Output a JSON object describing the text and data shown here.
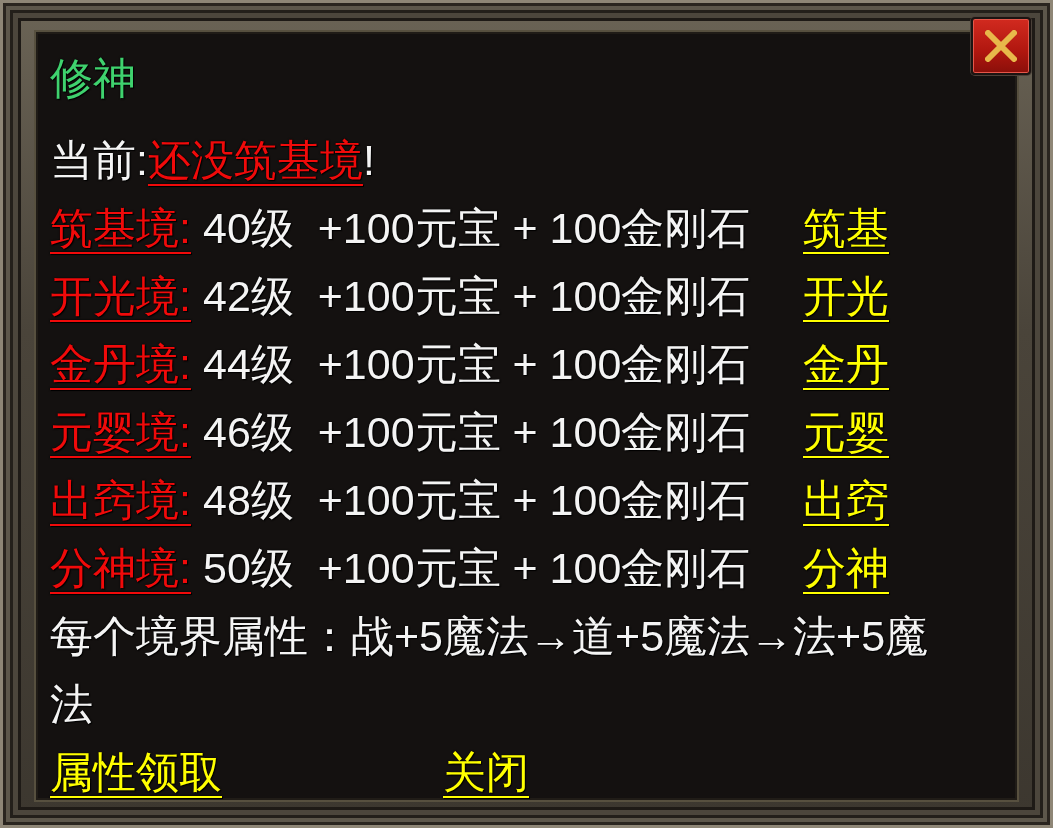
{
  "window": {
    "title": "修神"
  },
  "current": {
    "label": "当前:",
    "value": "还没筑基境",
    "suffix": "!"
  },
  "realms": [
    {
      "name": "筑基境:",
      "requirement": "40级  +100元宝 + 100金刚石",
      "action": "筑基"
    },
    {
      "name": "开光境:",
      "requirement": "42级  +100元宝 + 100金刚石",
      "action": "开光"
    },
    {
      "name": "金丹境:",
      "requirement": "44级  +100元宝 + 100金刚石",
      "action": "金丹"
    },
    {
      "name": "元婴境:",
      "requirement": "46级  +100元宝 + 100金刚石",
      "action": "元婴"
    },
    {
      "name": "出窍境:",
      "requirement": "48级  +100元宝 + 100金刚石",
      "action": "出窍"
    },
    {
      "name": "分神境:",
      "requirement": "50级  +100元宝 + 100金刚石",
      "action": "分神"
    }
  ],
  "description": "每个境界属性：战+5魔法→道+5魔法→法+5魔法",
  "buttons": [
    {
      "label": "属性领取"
    },
    {
      "label": "关闭"
    }
  ]
}
